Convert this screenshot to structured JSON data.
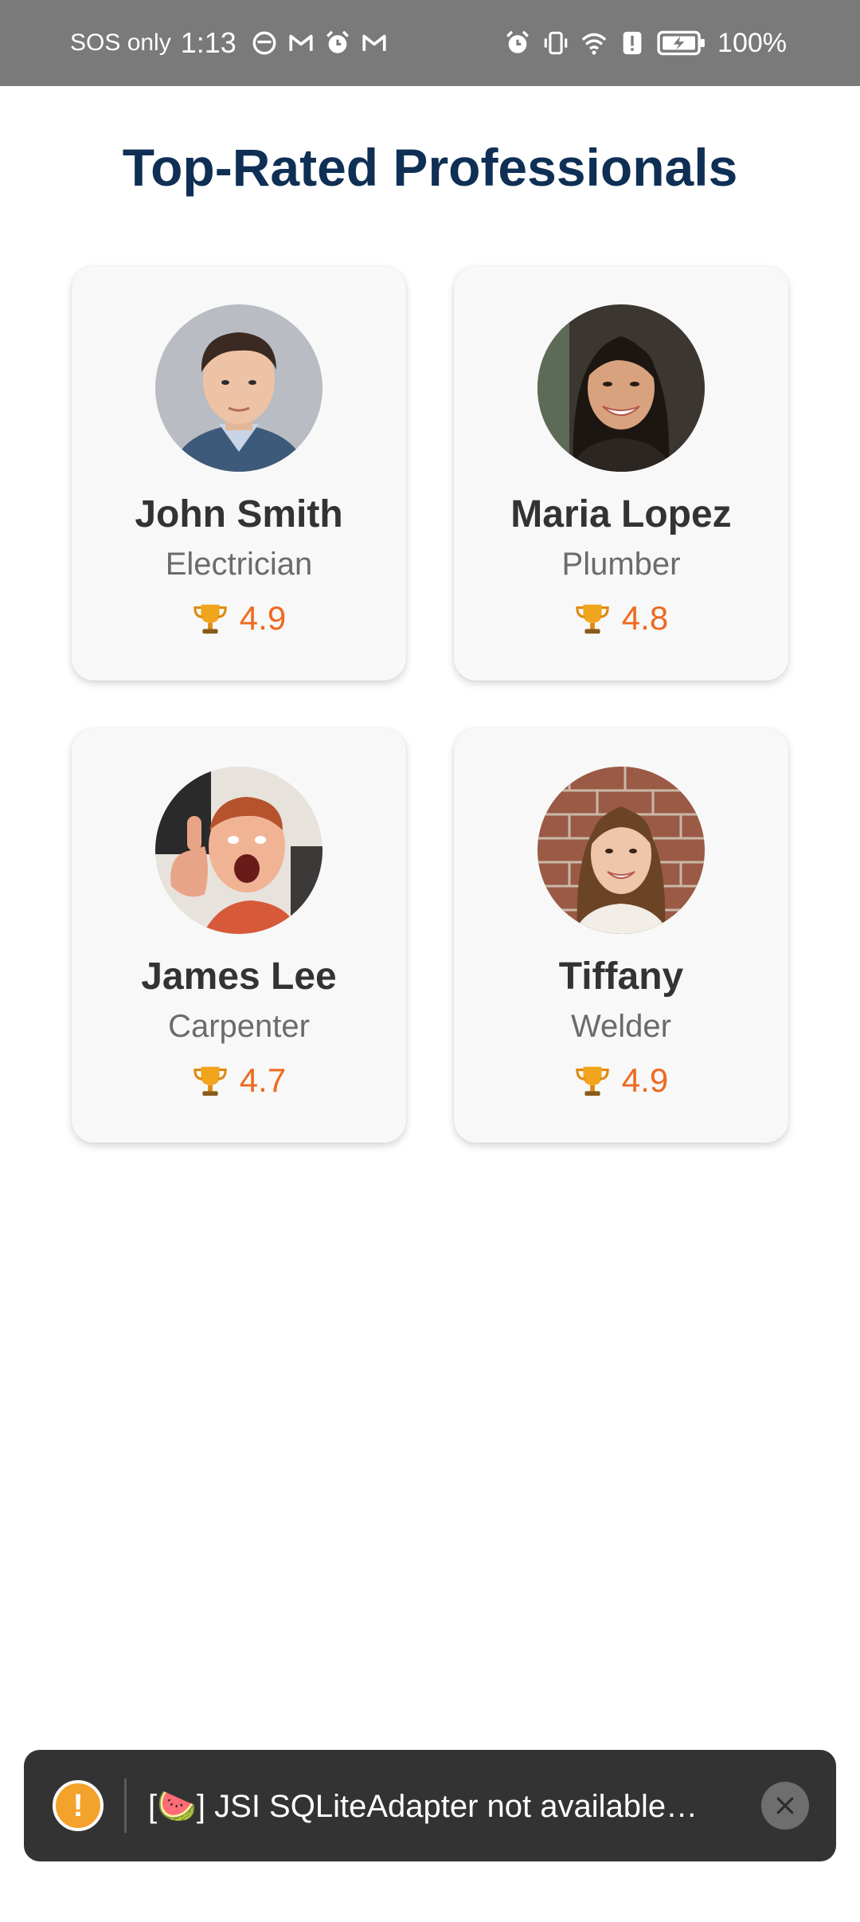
{
  "status_bar": {
    "carrier": "SOS only",
    "time": "1:13",
    "battery": "100%",
    "left_icons": [
      "notification-icon",
      "gmail-icon",
      "alarm-icon",
      "gmail-icon"
    ],
    "right_icons": [
      "alarm-icon",
      "vibrate-icon",
      "wifi-icon",
      "alert-icon",
      "battery-charging-icon"
    ]
  },
  "page": {
    "title": "Top-Rated Professionals"
  },
  "professionals": [
    {
      "name": "John Smith",
      "role": "Electrician",
      "rating": "4.9",
      "avatar": "man-portrait"
    },
    {
      "name": "Maria Lopez",
      "role": "Plumber",
      "rating": "4.8",
      "avatar": "woman-portrait"
    },
    {
      "name": "James Lee",
      "role": "Carpenter",
      "rating": "4.7",
      "avatar": "man-thumbs-up-portrait"
    },
    {
      "name": "Tiffany",
      "role": "Welder",
      "rating": "4.9",
      "avatar": "woman-brick-wall-portrait"
    }
  ],
  "toast": {
    "message": "[🍉] JSI SQLiteAdapter not available…",
    "icon": "warning-icon",
    "close_icon": "close-icon"
  },
  "colors": {
    "title": "#0f2f55",
    "rating": "#ee6a1f",
    "toast_bg": "#333333",
    "warning": "#f3a22b",
    "status_bar": "#7a7a7a"
  }
}
